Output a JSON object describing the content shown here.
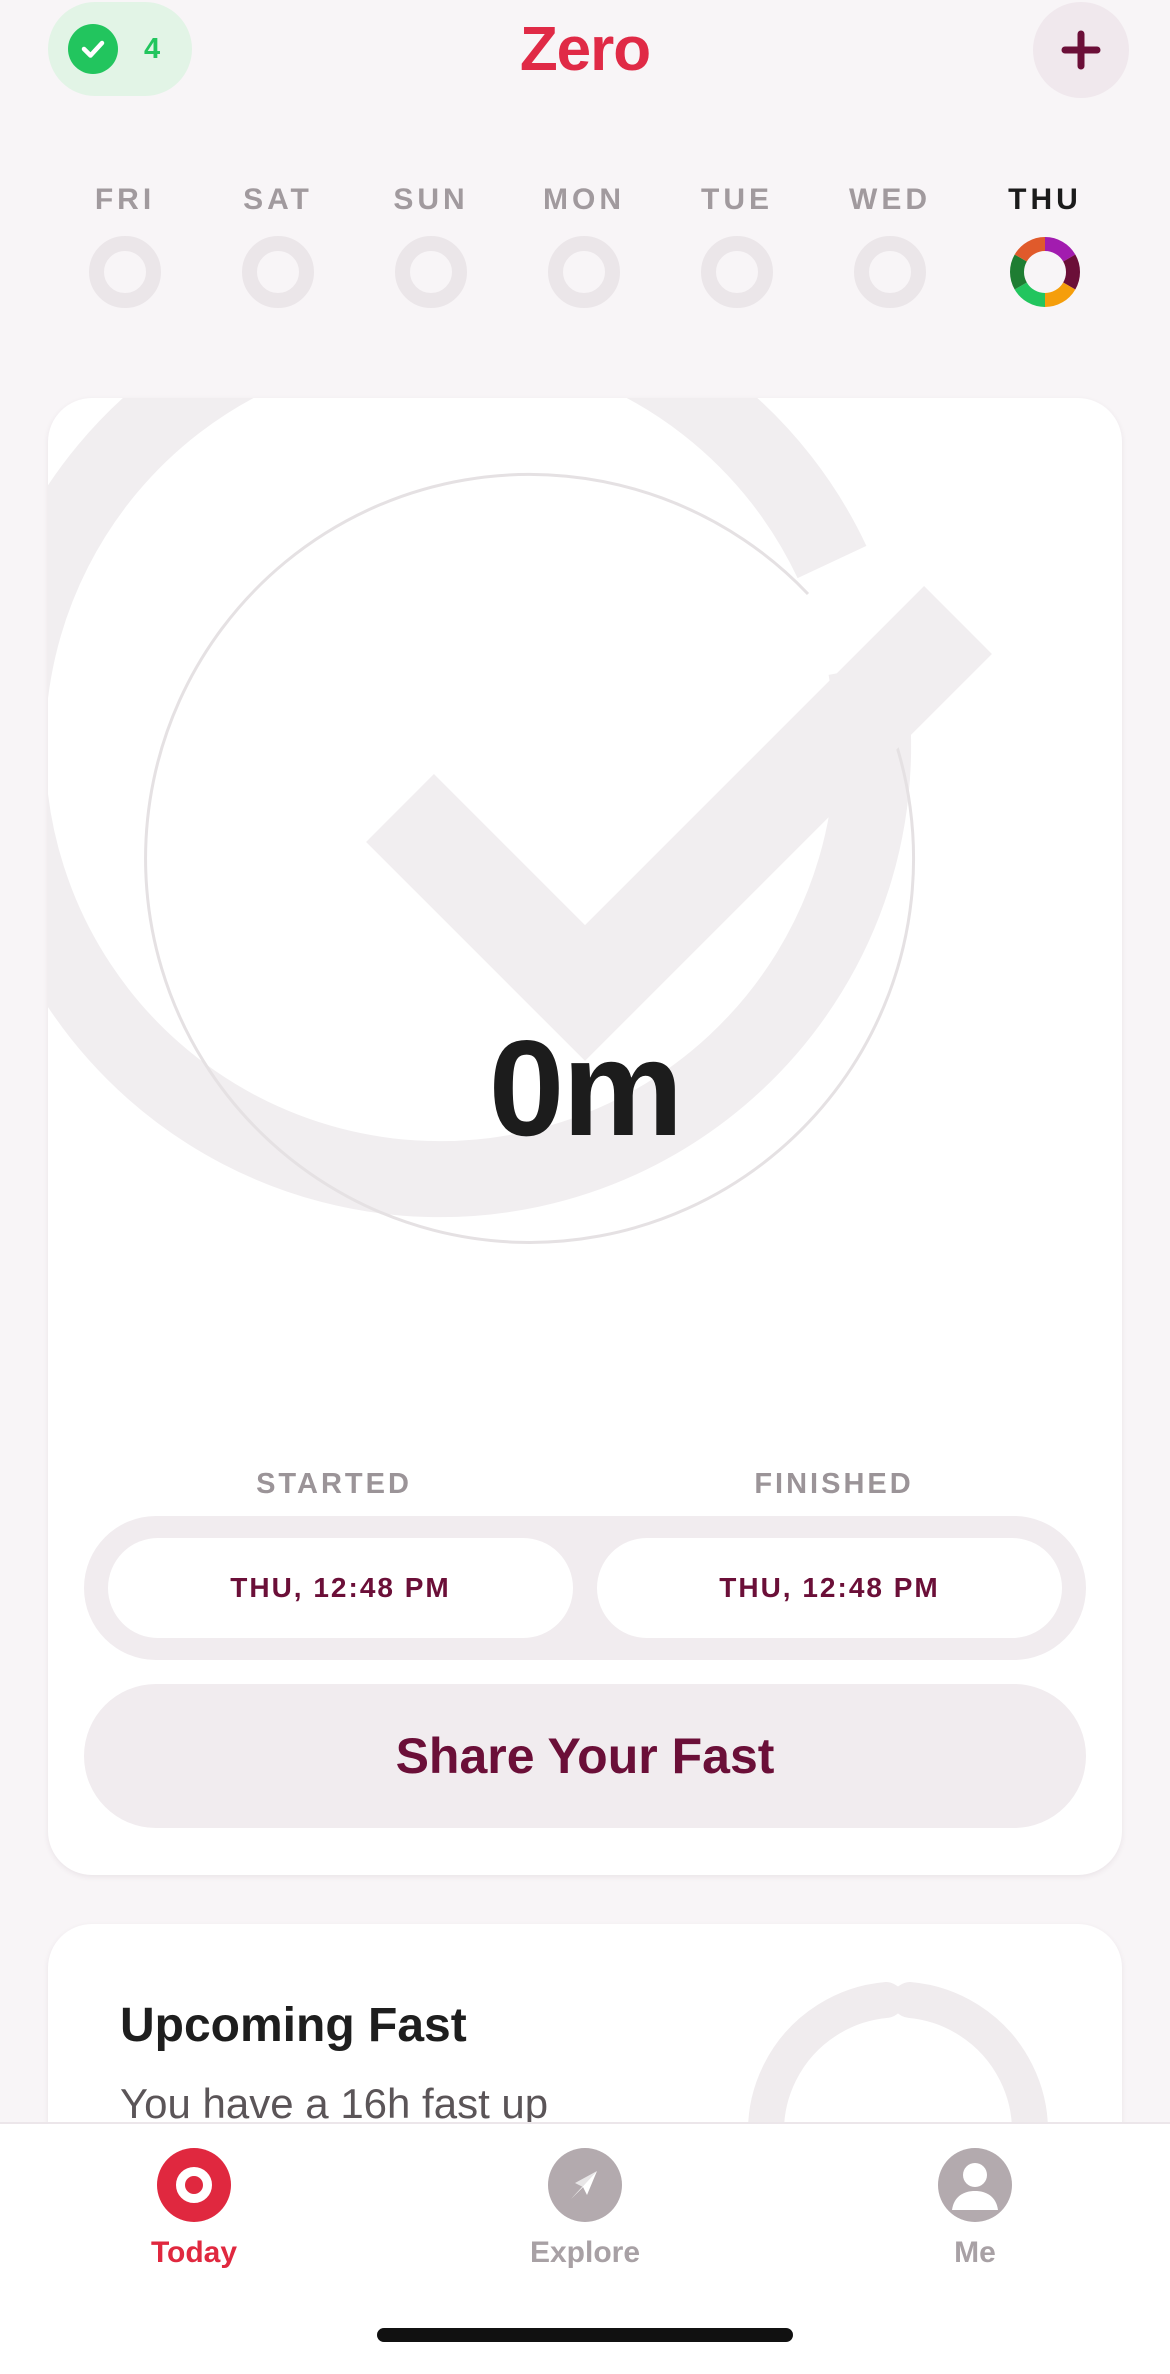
{
  "header": {
    "title": "Zero",
    "streak_count": "4",
    "add_icon": "plus-icon"
  },
  "week": {
    "days": [
      {
        "label": "FRI",
        "active": false
      },
      {
        "label": "SAT",
        "active": false
      },
      {
        "label": "SUN",
        "active": false
      },
      {
        "label": "MON",
        "active": false
      },
      {
        "label": "TUE",
        "active": false
      },
      {
        "label": "WED",
        "active": false
      },
      {
        "label": "THU",
        "active": true
      }
    ],
    "ring_colors": [
      "#a21caf",
      "#6b0f38",
      "#f59e0b",
      "#22c55e",
      "#1e7d32",
      "#e05a2b"
    ]
  },
  "timer": {
    "elapsed": "0m",
    "started_label": "STARTED",
    "finished_label": "FINISHED",
    "started_value": "THU, 12:48 PM",
    "finished_value": "THU, 12:48 PM",
    "share_label": "Share Your Fast",
    "progress": 0
  },
  "upcoming": {
    "title": "Upcoming Fast",
    "description": "You have a 16h fast up"
  },
  "tabs": [
    {
      "label": "Today",
      "icon": "today-ring-icon",
      "active": true
    },
    {
      "label": "Explore",
      "icon": "compass-icon",
      "active": false
    },
    {
      "label": "Me",
      "icon": "profile-icon",
      "active": false
    }
  ],
  "colors": {
    "brand": "#e02a46",
    "accent": "#6b0f38",
    "streak": "#22c55e",
    "background": "#f8f5f7"
  }
}
